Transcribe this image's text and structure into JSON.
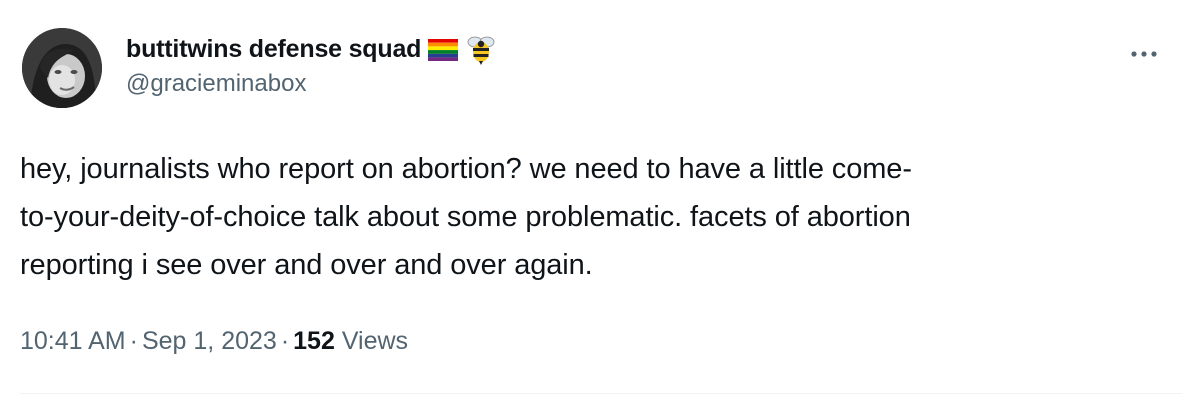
{
  "user": {
    "display_name": "buttitwins defense squad",
    "handle": "@gracieminabox",
    "emojis": [
      "rainbow-flag-icon",
      "bee-icon"
    ]
  },
  "tweet": {
    "text": "hey, journalists who report on abortion? we need to have a little come-\nto-your-deity-of-choice talk about some problematic. facets of abortion\nreporting i see over and over and over again."
  },
  "meta": {
    "time": "10:41 AM",
    "date": "Sep 1, 2023",
    "separator": "·",
    "views_count": "152",
    "views_label": "Views"
  },
  "colors": {
    "text": "#0f1419",
    "secondary": "#536471",
    "divider": "#eff3f4"
  }
}
